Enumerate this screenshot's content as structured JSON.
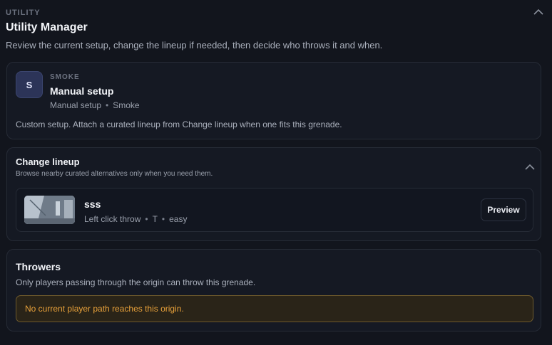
{
  "header": {
    "section_label": "UTILITY",
    "title": "Utility Manager",
    "subtitle": "Review the current setup, change the lineup if needed, then decide who throws it and when."
  },
  "current_setup": {
    "avatar_letter": "S",
    "type_label": "SMOKE",
    "name": "Manual setup",
    "meta_source": "Manual setup",
    "meta_type": "Smoke",
    "description": "Custom setup. Attach a curated lineup from Change lineup when one fits this grenade."
  },
  "change_lineup": {
    "title": "Change lineup",
    "description": "Browse nearby curated alternatives only when you need them.",
    "items": [
      {
        "name": "sss",
        "throw_type": "Left click throw",
        "side": "T",
        "difficulty": "easy",
        "preview_label": "Preview"
      }
    ]
  },
  "throwers": {
    "title": "Throwers",
    "description": "Only players passing through the origin can throw this grenade.",
    "warning": "No current player path reaches this origin."
  },
  "colors": {
    "background": "#12151d",
    "card": "#151923",
    "warning_text": "#e8a13a",
    "warning_bg": "#2a2418",
    "avatar_bg": "#2c3458"
  },
  "icons": {
    "collapse": "chevron-up-icon"
  }
}
